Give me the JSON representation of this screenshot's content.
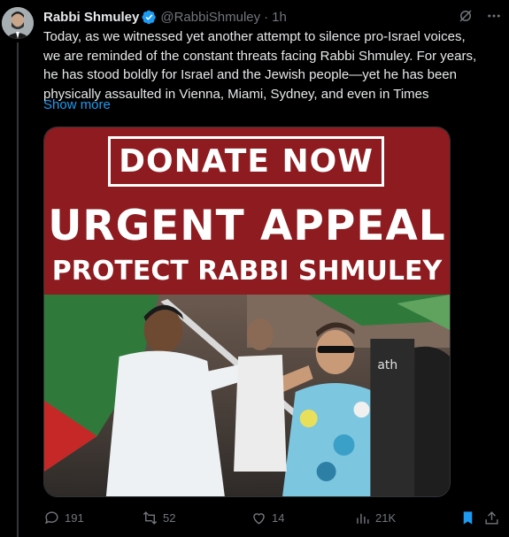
{
  "tweet": {
    "author_name": "Rabbi Shmuley",
    "handle": "@RabbiShmuley",
    "separator": "·",
    "time": "1h",
    "lines": [
      "Today, as we witnessed yet another attempt to silence pro-Israel voices,",
      "we are reminded of the constant threats facing Rabbi Shmuley. For years,",
      "he has stood boldly for Israel and the Jewish people—yet he has been",
      "physically assaulted in Vienna, Miami, Sydney, and even in Times"
    ],
    "show_more": "Show more"
  },
  "media": {
    "donate_text": "DONATE NOW",
    "appeal_text": "URGENT APPEAL",
    "protect_text": "PROTECT RABBI SHMULEY",
    "photo_overlay_text": "ath",
    "banner_color": "#8e1b1f"
  },
  "actions": {
    "replies": "191",
    "reposts": "52",
    "likes": "14",
    "views": "21K"
  },
  "icons": {
    "verified": "verified-badge-icon",
    "grok": "grok-icon",
    "more": "more-icon",
    "reply": "reply-icon",
    "repost": "repost-icon",
    "like": "like-icon",
    "views": "views-icon",
    "bookmark": "bookmark-icon",
    "share": "share-icon"
  },
  "colors": {
    "accent": "#1d9bf0",
    "muted": "#71767b",
    "text": "#e7e9ea"
  }
}
